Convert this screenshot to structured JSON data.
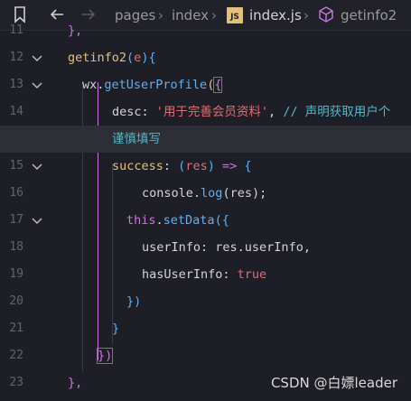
{
  "breadcrumb": {
    "items": [
      "pages",
      "index",
      "index.js",
      "getinfo2"
    ],
    "badge": "JS"
  },
  "lines": [
    {
      "num": "11",
      "text": "},"
    },
    {
      "num": "12",
      "text": "getinfo2(e){"
    },
    {
      "num": "13",
      "text": "wx.getUserProfile({"
    },
    {
      "num": "14",
      "text_parts": [
        "desc",
        ": ",
        "'用于完善会员资料'",
        ", ",
        "// 声明获取用户个"
      ]
    },
    {
      "num": "",
      "text": "谨慎填写"
    },
    {
      "num": "15",
      "text_parts": [
        "success",
        ": ",
        "(",
        "res",
        ") ",
        "=>",
        " {"
      ]
    },
    {
      "num": "16",
      "text_parts": [
        "console",
        ".",
        "log",
        "(res);"
      ]
    },
    {
      "num": "17",
      "text_parts": [
        "this",
        ".",
        "setData",
        "({"
      ]
    },
    {
      "num": "18",
      "text_parts": [
        "userInfo",
        ": res.userInfo,"
      ]
    },
    {
      "num": "19",
      "text_parts": [
        "hasUserInfo",
        ": ",
        "true"
      ]
    },
    {
      "num": "20",
      "text": "})"
    },
    {
      "num": "21",
      "text": "}"
    },
    {
      "num": "22",
      "text": "})"
    },
    {
      "num": "23",
      "text": "},"
    }
  ],
  "watermark": "CSDN @白嫖leader",
  "colors": {
    "background": "#1e1f26",
    "highlight_line": "#2d2e36",
    "keyword": "#c678dd",
    "string": "#e06c75",
    "function": "#61afef",
    "comment": "#56b6c2"
  }
}
